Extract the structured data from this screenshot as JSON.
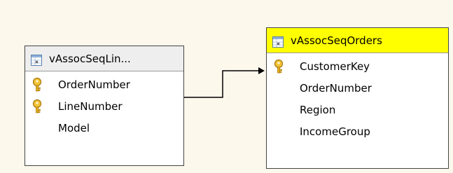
{
  "tables": [
    {
      "name": "vAssocSeqLin...",
      "columns": [
        {
          "name": "OrderNumber",
          "key": true
        },
        {
          "name": "LineNumber",
          "key": true
        },
        {
          "name": "Model",
          "key": false
        }
      ]
    },
    {
      "name": "vAssocSeqOrders",
      "columns": [
        {
          "name": "CustomerKey",
          "key": true
        },
        {
          "name": "OrderNumber",
          "key": false
        },
        {
          "name": "Region",
          "key": false
        },
        {
          "name": "IncomeGroup",
          "key": false
        }
      ]
    }
  ],
  "colors": {
    "selected_header": "#ffff00",
    "header": "#eeeeee",
    "background": "#fdf8ec",
    "key_gold": "#e8b21c"
  }
}
